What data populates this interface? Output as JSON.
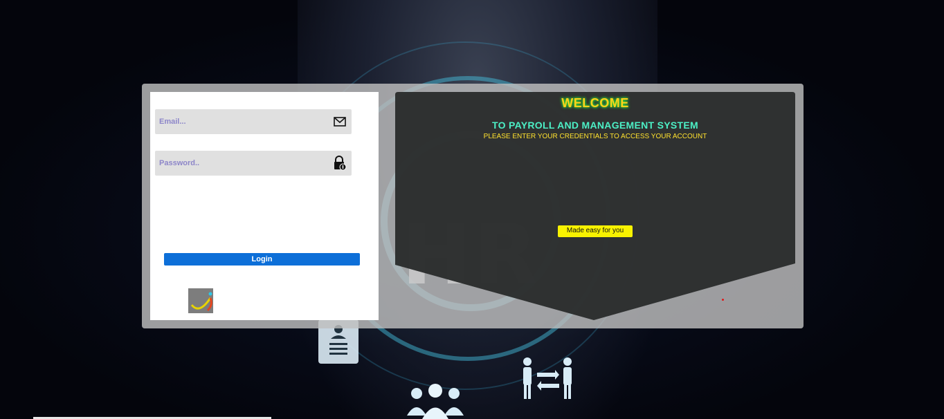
{
  "login": {
    "email_placeholder": "Email...",
    "email_value": "",
    "password_placeholder": "Password..",
    "password_value": "",
    "login_label": "Login",
    "email_icon": "envelope-icon",
    "password_icon": "lock-icon"
  },
  "welcome": {
    "title": "WELCOME",
    "subtitle": "TO PAYROLL AND MANAGEMENT SYSTEM",
    "instruction": "PLEASE ENTER YOUR CREDENTIALS TO ACCESS YOUR ACCOUNT",
    "badge": "Made easy for you"
  },
  "background": {
    "hr_text": "HR"
  },
  "colors": {
    "login_button": "#0d6fd8",
    "welcome_title": "#ffd21a",
    "welcome_subtitle": "#4cf0c6",
    "instruction": "#ffe12e",
    "badge": "#f8f200",
    "welcome_panel": "#2b2d2d"
  }
}
